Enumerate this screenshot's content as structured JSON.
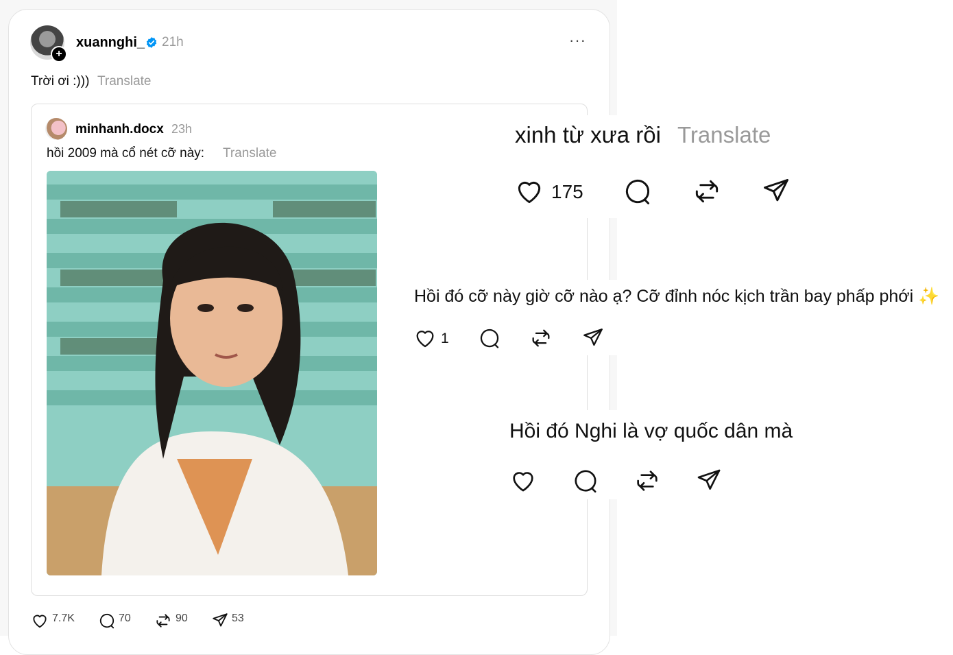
{
  "post": {
    "username": "xuannghi_",
    "time": "21h",
    "text": "Trời ơi :)))",
    "translate": "Translate",
    "more": "···",
    "quoted": {
      "username": "minhanh.docx",
      "time": "23h",
      "text": "hồi 2009 mà cổ nét cỡ này:",
      "translate": "Translate"
    },
    "likes": "7.7K",
    "comments": "70",
    "reposts": "90",
    "shares": "53"
  },
  "comments": [
    {
      "text": "xinh từ xưa rồi",
      "translate": "Translate",
      "likes": "175"
    },
    {
      "text": "Hồi đó cỡ này giờ cỡ nào ạ? Cỡ đỉnh nóc kịch trần bay phấp phới ✨",
      "likes": "1"
    },
    {
      "text": "Hồi đó Nghi là vợ quốc dân mà",
      "likes": ""
    }
  ],
  "colors": {
    "muted": "#999999",
    "verified": "#0095f6",
    "border": "#e2e2e2"
  }
}
